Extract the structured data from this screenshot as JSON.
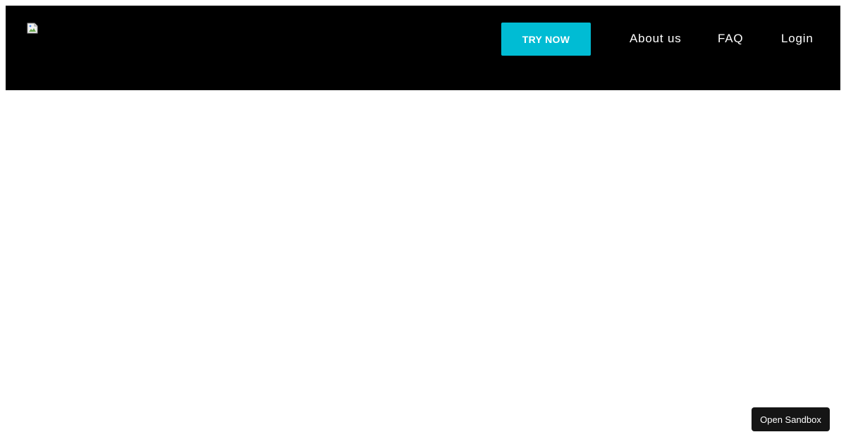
{
  "header": {
    "logo_icon": "broken-image-icon",
    "cta_label": "TRY NOW",
    "nav": {
      "about": "About us",
      "faq": "FAQ",
      "login": "Login"
    }
  },
  "sandbox": {
    "label": "Open Sandbox"
  },
  "colors": {
    "header_bg": "#000000",
    "accent": "#00bcd4",
    "nav_text": "#ffffff",
    "sandbox_bg": "#151515"
  }
}
